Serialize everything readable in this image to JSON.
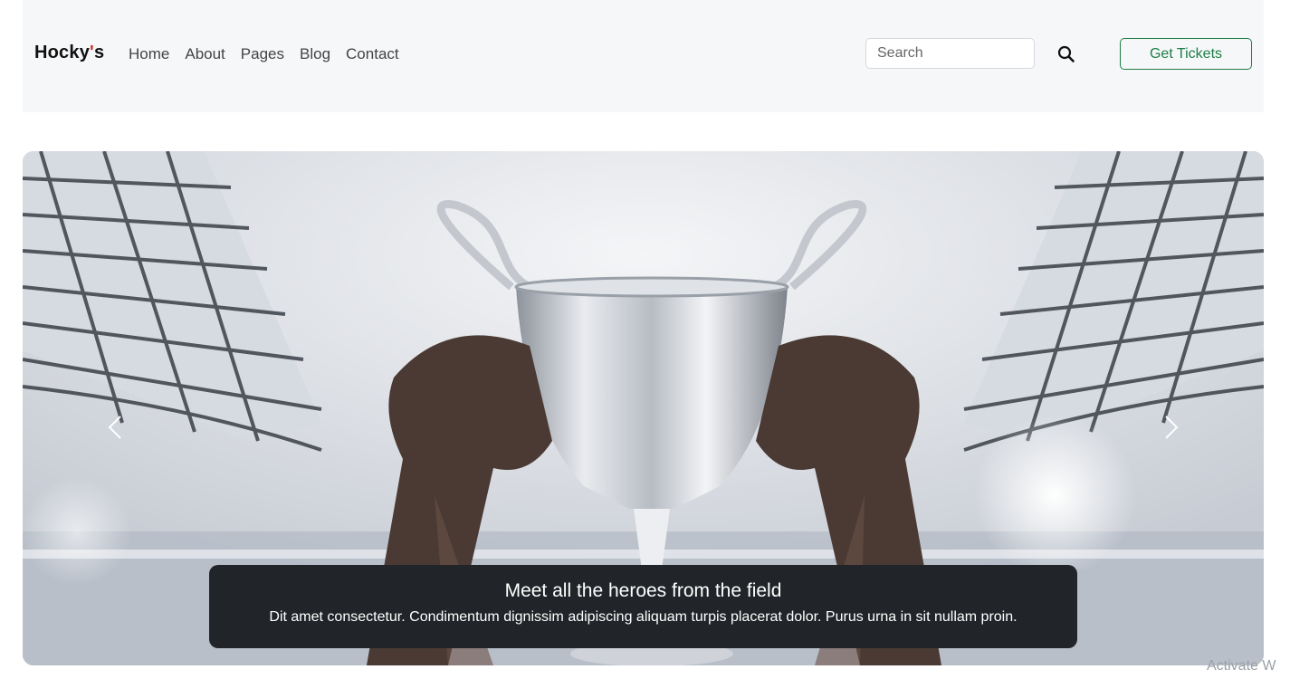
{
  "navbar": {
    "brand": "Hocky",
    "brand_apostrophe": "'",
    "brand_suffix": "s",
    "links": [
      "Home",
      "About",
      "Pages",
      "Blog",
      "Contact"
    ],
    "search_placeholder": "Search",
    "search_icon": "search-icon",
    "tickets_label": "Get Tickets",
    "accent_color": "#1e7e46"
  },
  "hero": {
    "image": "trophy-raised-in-stadium",
    "prev_icon": "chevron-left-icon",
    "next_icon": "chevron-right-icon",
    "caption": {
      "title": "Meet all the heroes from the field",
      "text": "Dit amet consectetur. Condimentum dignissim adipiscing aliquam turpis placerat dolor. Purus urna in sit nullam proin."
    }
  },
  "watermark": "Activate W"
}
